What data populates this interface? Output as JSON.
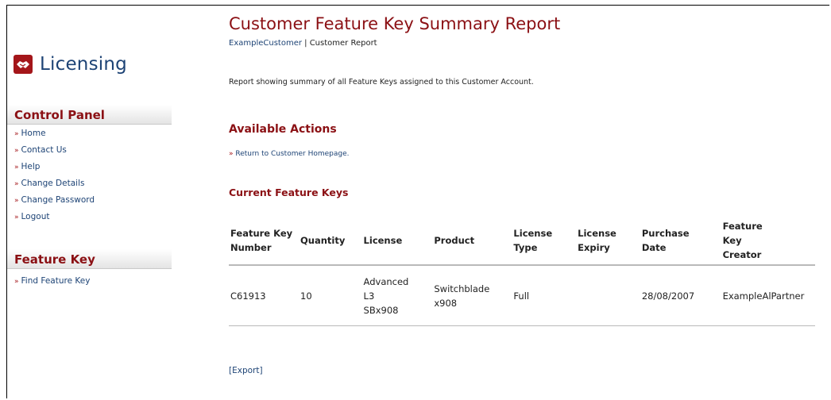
{
  "brand": {
    "name": "Licensing",
    "icon": "handshake-icon",
    "accent": "#a4161a",
    "link_color": "#1d4375"
  },
  "sidebar": {
    "control_panel_title": "Control Panel",
    "control_panel_items": [
      {
        "label": "Home"
      },
      {
        "label": "Contact Us"
      },
      {
        "label": "Help"
      },
      {
        "label": "Change Details"
      },
      {
        "label": "Change Password"
      },
      {
        "label": "Logout"
      }
    ],
    "feature_key_title": "Feature Key",
    "feature_key_items": [
      {
        "label": "Find Feature Key"
      }
    ]
  },
  "main": {
    "title": "Customer Feature Key Summary Report",
    "breadcrumb_customer": "ExampleCustomer",
    "breadcrumb_sep": " | ",
    "breadcrumb_page": "Customer Report",
    "description": "Report showing summary of all Feature Keys assigned to this Customer Account.",
    "actions_title": "Available Actions",
    "action_return": "Return to Customer Homepage.",
    "keys_title": "Current Feature Keys",
    "export_label": "[Export]"
  },
  "table": {
    "headers": [
      "Feature Key Number",
      "Quantity",
      "License",
      "Product",
      "License Type",
      "License Expiry",
      "Purchase Date",
      "Feature Key Creator"
    ],
    "rows": [
      [
        "C61913",
        "10",
        "Advanced L3 SBx908",
        "Switchblade x908",
        "Full",
        "",
        "28/08/2007",
        "ExampleAlPartner"
      ]
    ]
  }
}
